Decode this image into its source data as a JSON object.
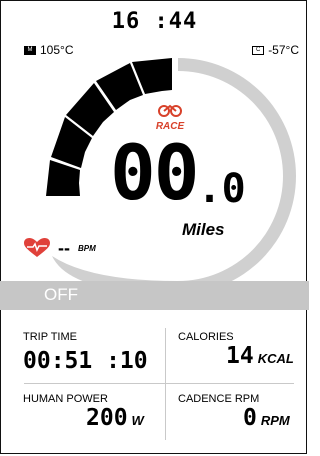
{
  "status": {
    "time": "16 :44",
    "motor_temp": "105°C",
    "controller_temp": "-57°C",
    "motor_icon": "motor-temp-icon",
    "controller_icon": "controller-temp-icon"
  },
  "gauge": {
    "level": 0.0,
    "segments_total": 6,
    "active_color": "#000000",
    "track_color": "#d0d0d0",
    "brand_label": "RACE",
    "speed_main": "00",
    "speed_dec": ".0",
    "unit": "Miles"
  },
  "heart_rate": {
    "icon": "heart-icon",
    "value": "--",
    "unit": "BPM",
    "color": "#e0413a"
  },
  "mode": {
    "label": "OFF"
  },
  "metrics": {
    "trip_time": {
      "label": "TRIP TIME",
      "value": "00:51 :10"
    },
    "calories": {
      "label": "CALORIES",
      "value": "14",
      "unit": "KCAL"
    },
    "human_power": {
      "label": "HUMAN POWER",
      "value": "200",
      "unit": "W"
    },
    "cadence": {
      "label": "CADENCE RPM",
      "value": "0",
      "unit": "RPM"
    }
  }
}
